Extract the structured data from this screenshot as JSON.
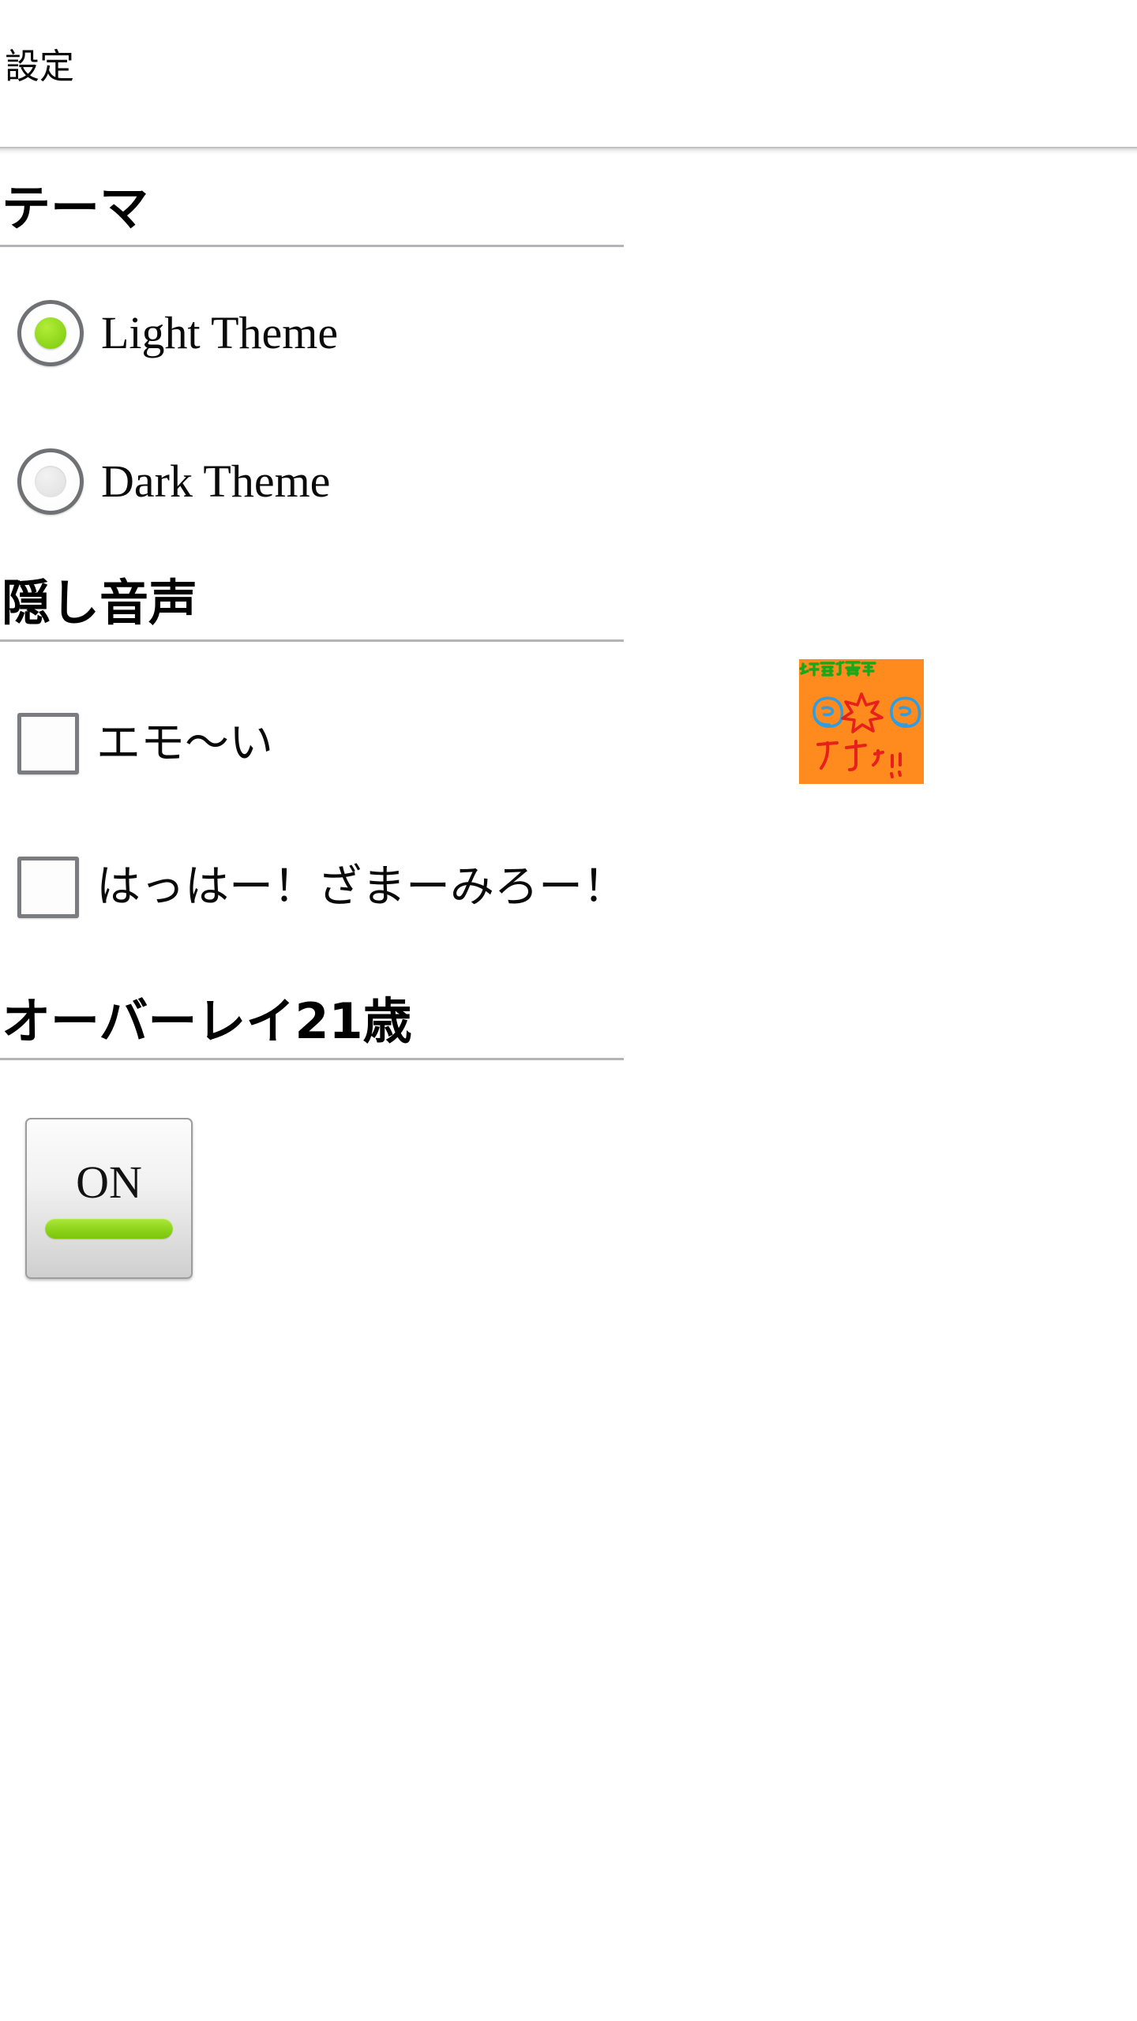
{
  "app": {
    "title": "設定"
  },
  "sections": [
    {
      "id": "theme",
      "title": "テーマ",
      "type": "radio-group",
      "options": [
        {
          "label": "Light Theme",
          "selected": true,
          "icon": "radio-checked-icon"
        },
        {
          "label": "Dark Theme",
          "selected": false,
          "icon": "radio-unchecked-icon"
        }
      ]
    },
    {
      "id": "hidden-audio",
      "title": "隠し音声",
      "type": "checkbox-group",
      "options": [
        {
          "label": "エモ〜い",
          "checked": false,
          "icon": "checkbox-unchecked-icon"
        },
        {
          "label": "はっはー！ざまーみろー！",
          "checked": false,
          "icon": "checkbox-unchecked-icon"
        }
      ]
    },
    {
      "id": "overlay",
      "title": "オーバーレイ21歳",
      "type": "toggle",
      "toggle": {
        "label": "ON",
        "state": "on"
      }
    }
  ],
  "thumbnail": {
    "name": "hidden-audio-artwork",
    "top_text": "21歳り音声",
    "bottom_text": "カチッ!!",
    "background_color": "#ff8a1e",
    "top_text_color": "#18a81a",
    "hand_outline_color": "#2f9de0",
    "burst_color": "#e8201c",
    "bottom_text_color": "#e8201c"
  },
  "colors": {
    "accent_green": "#8ed41b",
    "divider": "#b3b3b8",
    "control_border": "#7a7c80",
    "text": "#0a0a0a",
    "background": "#ffffff"
  }
}
